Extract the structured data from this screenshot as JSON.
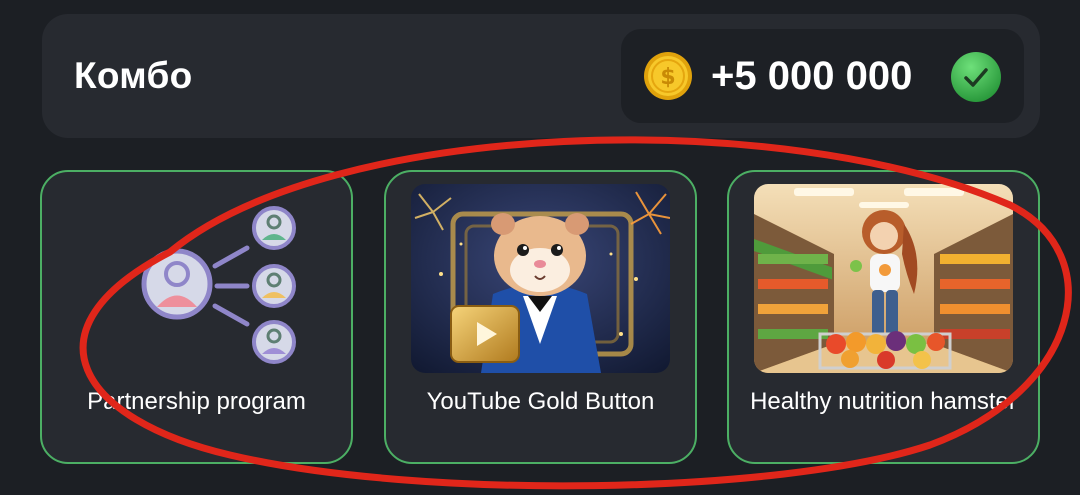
{
  "combo": {
    "title": "Комбо",
    "reward": "+5 000 000",
    "coin_icon": "gold-dollar-coin-icon",
    "status_icon": "green-check-icon"
  },
  "cards": [
    {
      "label": "Partnership program",
      "image": "partners-network-icon"
    },
    {
      "label": "YouTube Gold Button",
      "image": "hamster-in-tuxedo-with-gold-play-button"
    },
    {
      "label": "Healthy nutrition hamster",
      "image": "hamster-in-grocery-store"
    }
  ],
  "colors": {
    "background": "#1c1f24",
    "panel": "#272a30",
    "card_border": "#4caf64",
    "annotation": "#e0261a",
    "coin": "#f5c518",
    "check": "#3cb44b"
  }
}
